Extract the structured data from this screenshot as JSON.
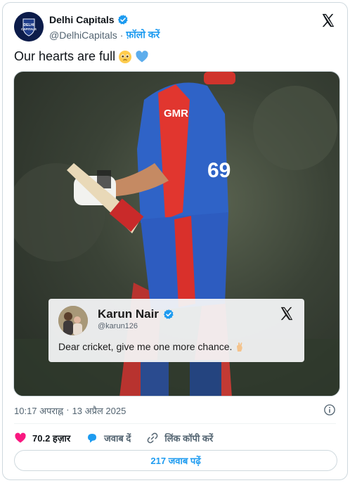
{
  "author": {
    "name": "Delhi Capitals",
    "handle": "@DelhiCapitals",
    "separator": "·",
    "follow_label": "फ़ॉलो करें",
    "avatar_text": "DELHI CAPITALS"
  },
  "tweet": {
    "text": "Our hearts are full",
    "emojis": [
      "pleading-face-emoji",
      "blue-heart-emoji"
    ]
  },
  "media": {
    "jersey_text": "GMR",
    "number": "69"
  },
  "quote": {
    "name": "Karun Nair",
    "handle": "@karun126",
    "text": "Dear cricket, give me one more chance.",
    "emoji": "crossed-fingers-emoji"
  },
  "meta": {
    "time": "10:17 अपराह्न",
    "separator": "·",
    "date": "13 अप्रैल 2025"
  },
  "actions": {
    "likes": "70.2 हज़ार",
    "reply_label": "जवाब दें",
    "copy_link_label": "लिंक कॉपी करें"
  },
  "replies_button": "217 जवाब पढ़ें",
  "colors": {
    "accent": "#1d9bf0",
    "like": "#f91880",
    "text": "#0f1419",
    "muted": "#536471"
  }
}
